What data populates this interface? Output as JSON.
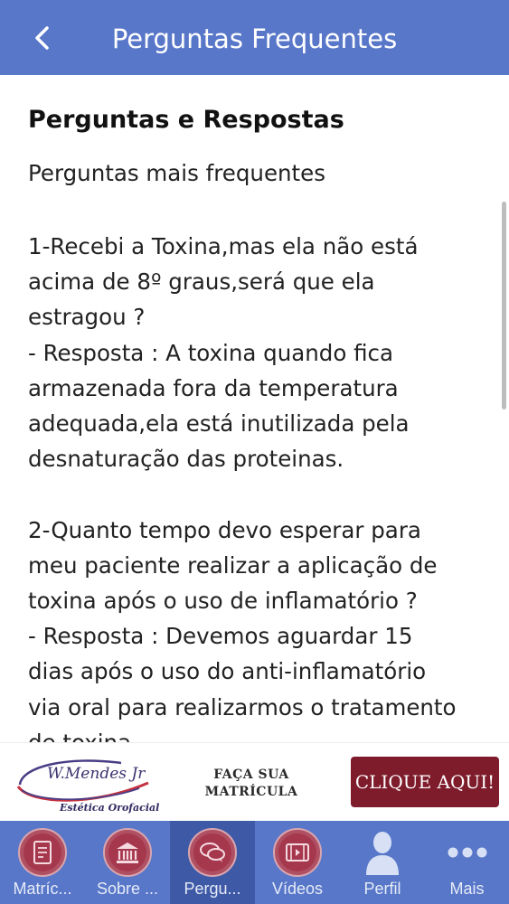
{
  "header": {
    "title": "Perguntas Frequentes"
  },
  "content": {
    "title": "Perguntas e Respostas",
    "subtitle": "Perguntas mais frequentes",
    "q1": {
      "lines": [
        "1-Recebi a Toxina,mas ela não está",
        "acima de 8º graus,será que ela",
        "estragou ?",
        "- Resposta : A toxina quando fica",
        "armazenada fora da temperatura",
        "adequada,ela está inutilizada pela",
        "desnaturação das proteinas."
      ]
    },
    "q2": {
      "lines": [
        "2-Quanto tempo devo esperar para",
        "meu paciente realizar a aplicação de",
        "toxina após o uso de inflamatório ?",
        "- Resposta : Devemos aguardar 15",
        "dias após o uso do anti-inflamatório",
        "via oral para realizarmos o tratamento",
        "de toxina."
      ]
    }
  },
  "banner": {
    "logo_name": "W.Mendes Jr",
    "logo_subtitle": "Estética Orofacial",
    "promo_line1": "FAÇA SUA",
    "promo_line2": "MATRÍCULA",
    "cta_label": "CLIQUE AQUI!"
  },
  "tabs": [
    {
      "label": "Matríc...",
      "icon": "document-icon"
    },
    {
      "label": "Sobre ...",
      "icon": "bank-icon"
    },
    {
      "label": "Pergu...",
      "icon": "chat-bubbles-icon",
      "active": true
    },
    {
      "label": "Vídeos",
      "icon": "film-icon"
    },
    {
      "label": "Perfil",
      "icon": "person-icon"
    },
    {
      "label": "Mais",
      "icon": "more-dots-icon"
    }
  ],
  "colors": {
    "header": "#5877c9",
    "tab_active": "#3e59a6",
    "tab_icon": "#a6384e",
    "cta": "#7e1c2c"
  }
}
